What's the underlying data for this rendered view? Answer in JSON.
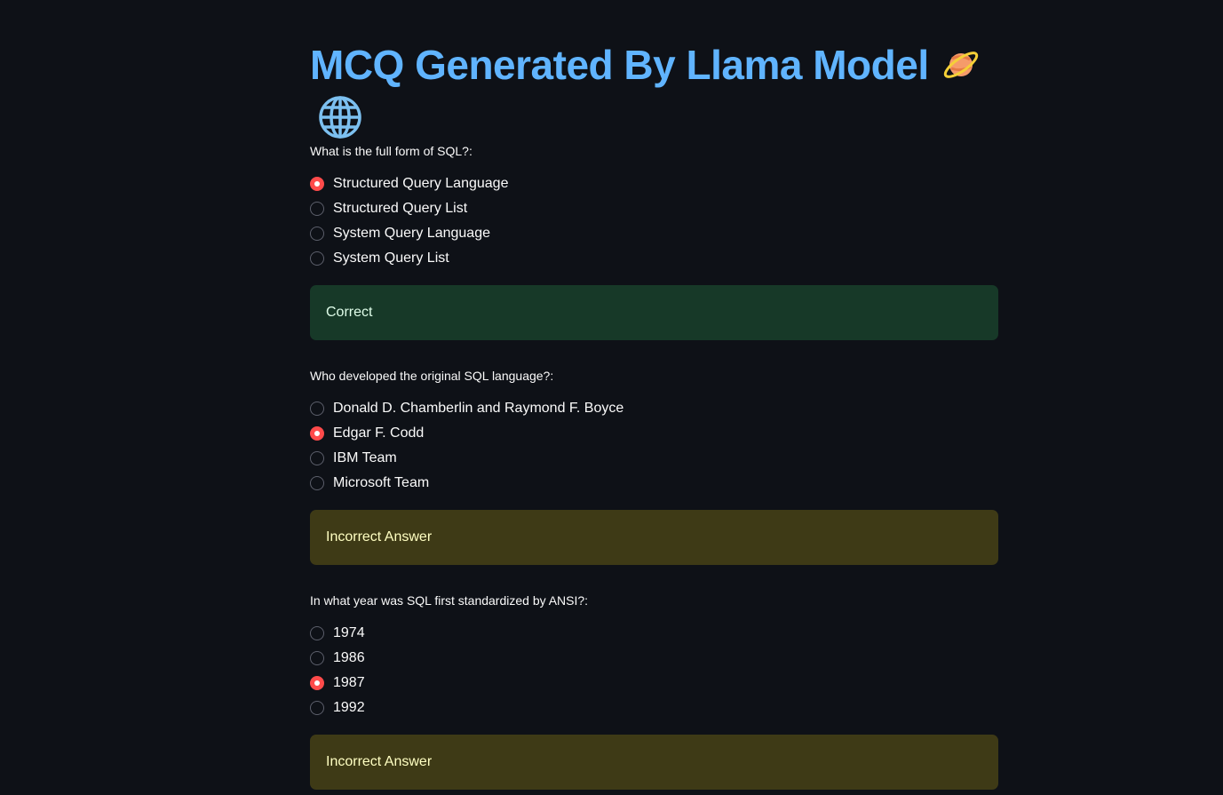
{
  "page": {
    "title": "MCQ Generated By Llama Model",
    "title_emoji": "ringed-planet-icon",
    "subtitle_emoji": "globe-icon"
  },
  "colors": {
    "background": "#0e1117",
    "title": "#60b4ff",
    "radio_selected": "#ff4b4b",
    "success_bg": "#173928",
    "warning_bg": "#3e3a16"
  },
  "questions": [
    {
      "label": "What is the full form of SQL?:",
      "options": [
        "Structured Query Language",
        "Structured Query List",
        "System Query Language",
        "System Query List"
      ],
      "selected_index": 0,
      "result": "Correct",
      "result_type": "success"
    },
    {
      "label": "Who developed the original SQL language?:",
      "options": [
        "Donald D. Chamberlin and Raymond F. Boyce",
        "Edgar F. Codd",
        "IBM Team",
        "Microsoft Team"
      ],
      "selected_index": 1,
      "result": "Incorrect Answer",
      "result_type": "warning"
    },
    {
      "label": "In what year was SQL first standardized by ANSI?:",
      "options": [
        "1974",
        "1986",
        "1987",
        "1992"
      ],
      "selected_index": 2,
      "result": "Incorrect Answer",
      "result_type": "warning"
    }
  ]
}
